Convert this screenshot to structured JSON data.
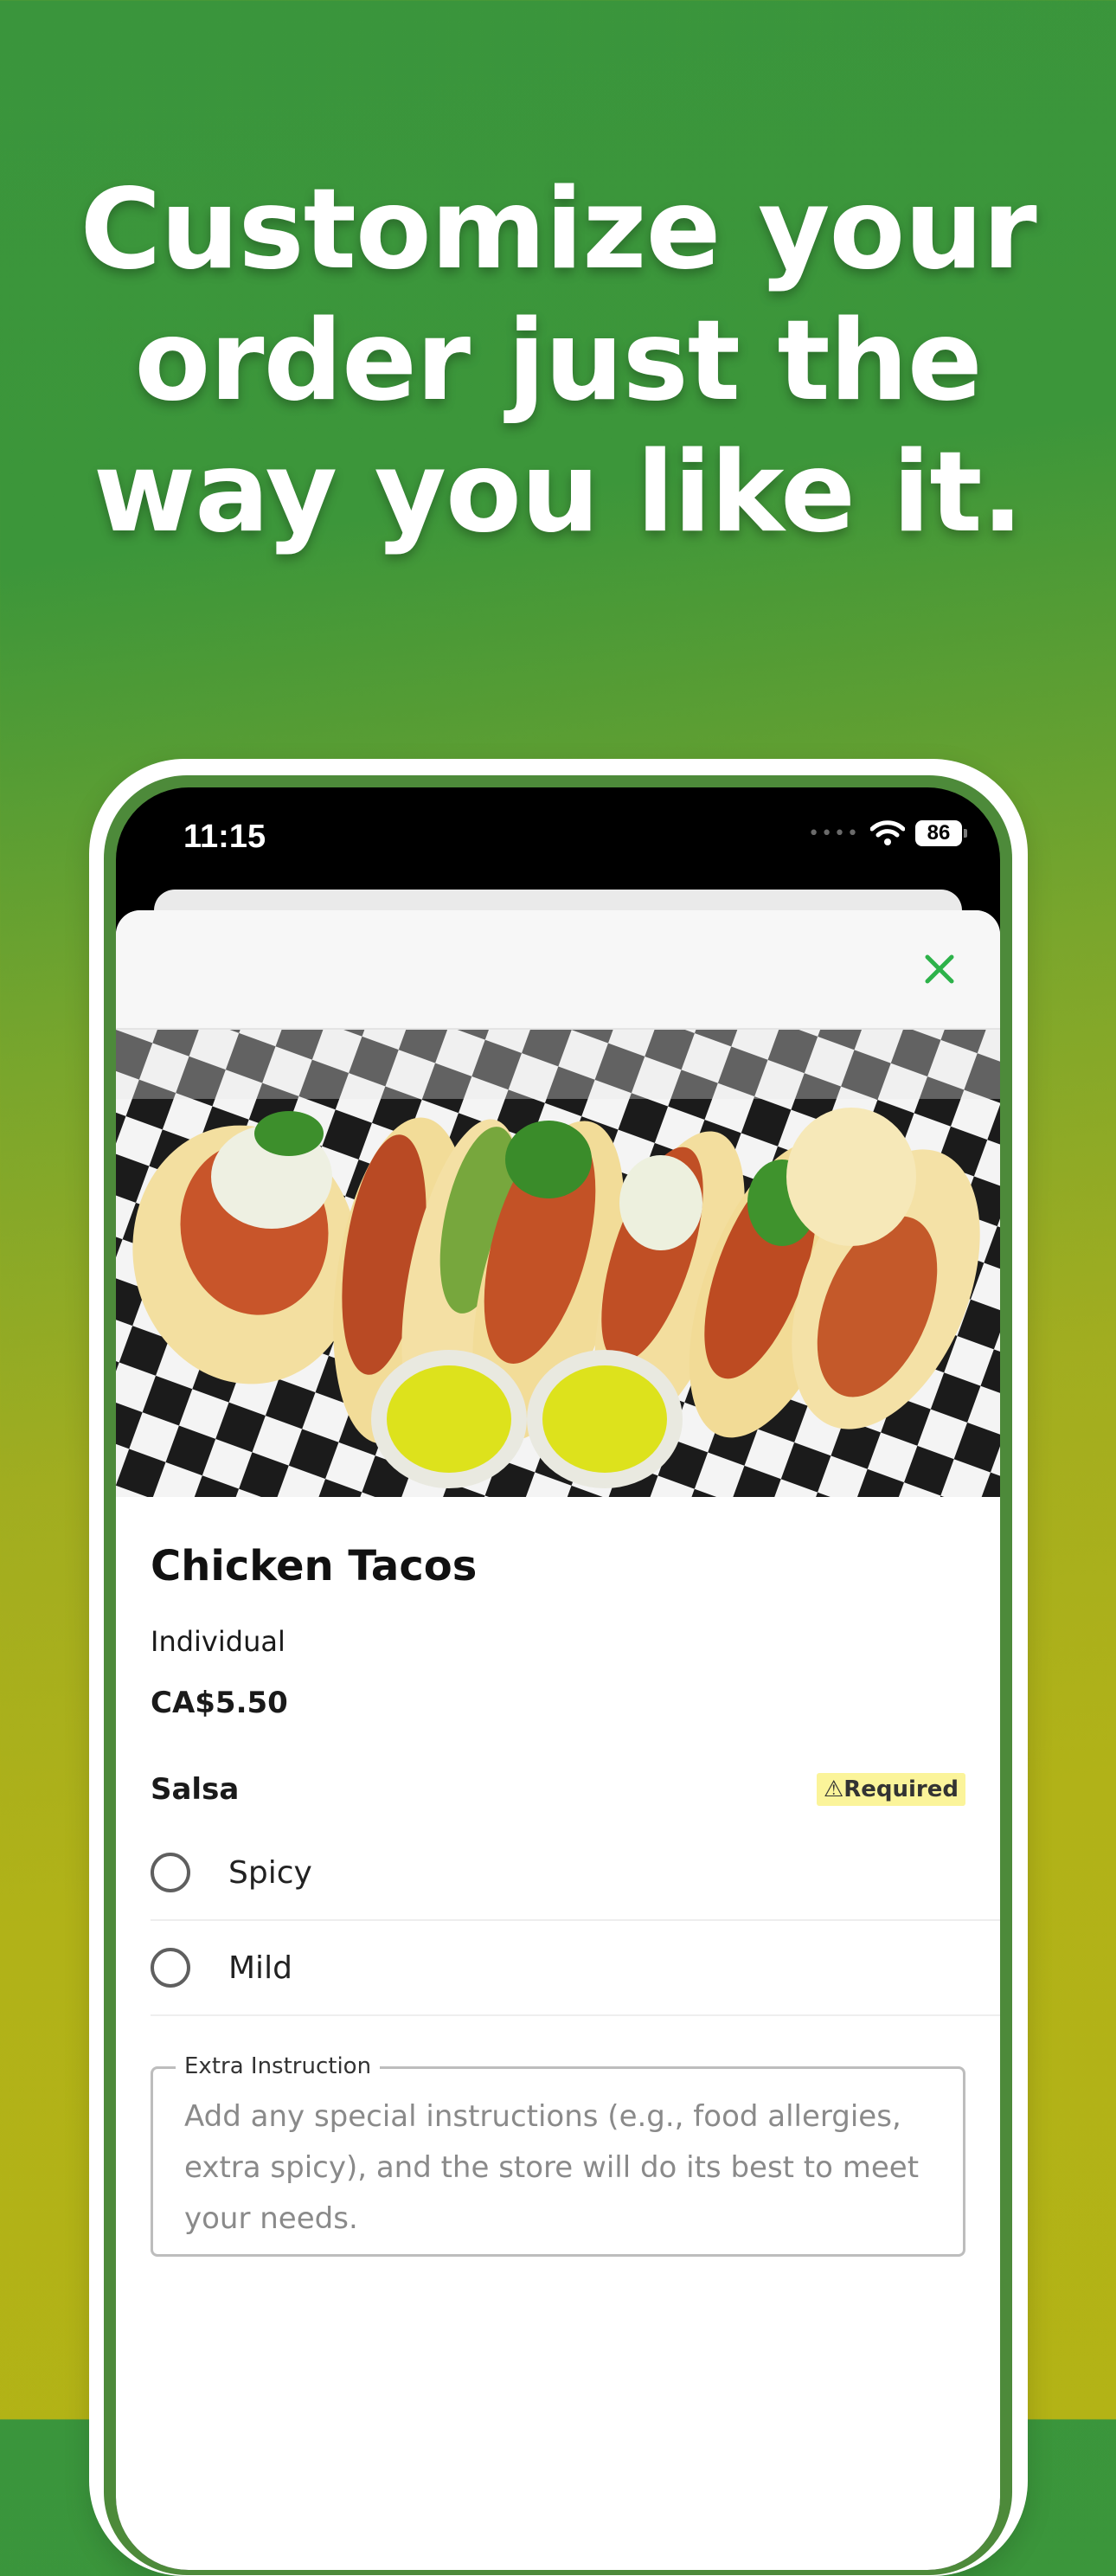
{
  "promo": {
    "headline_line1": "Customize your",
    "headline_line2": "order just the",
    "headline_line3": "way you like it."
  },
  "status_bar": {
    "time": "11:15",
    "battery": "86",
    "icons": [
      "signal-dots-icon",
      "wifi-icon",
      "battery-icon"
    ]
  },
  "sheet": {
    "close_icon": "close-icon",
    "accent_color": "#2db24a"
  },
  "item": {
    "name": "Chicken Tacos",
    "variant": "Individual",
    "price": "CA$5.50",
    "photo": "chicken-tacos-photo"
  },
  "modifier_group": {
    "title": "Salsa",
    "required_label": "Required",
    "options": [
      {
        "label": "Spicy",
        "selected": false
      },
      {
        "label": "Mild",
        "selected": false
      }
    ]
  },
  "extra_instruction": {
    "label": "Extra Instruction",
    "placeholder": "Add any special instructions (e.g., food allergies, extra spicy), and the store will do its best to meet your needs."
  },
  "colors": {
    "background_top": "#3a953c",
    "background_bottom": "#b3b316",
    "required_badge": "#fbf49a"
  }
}
